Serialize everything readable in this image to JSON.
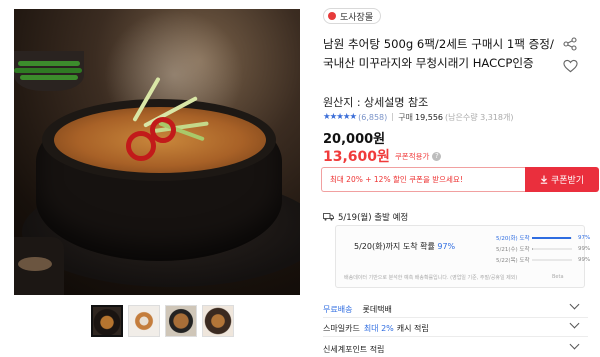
{
  "product": {
    "brand": "도사장몰",
    "title": "남원 추어탕 500g 6팩/2세트 구매시 1팩 증정/국내산 미꾸라지와 무청시래기 HACCP인증",
    "origin": "원산지 : 상세설명 참조",
    "rating": {
      "stars": "★★★★★",
      "reviews": "(6,858)",
      "purchases_label": "구매",
      "purchases": "19,556",
      "remaining": "(남은수량 3,318개)"
    },
    "price": "20,000원",
    "coupon_price": "13,600원",
    "coupon_tag": "쿠폰적용가",
    "coupon_help": "?"
  },
  "coupon": {
    "message": "최대 20% + 12% 할인 쿠폰을 받으세요!",
    "button": "쿠폰받기",
    "button_icon": "download-icon"
  },
  "delivery": {
    "departure": "5/19(월) 출발 예정",
    "forecast_main_prefix": "5/20(화)까지 도착 확률",
    "forecast_main_pct": "97%",
    "rows": [
      {
        "label": "5/20(화) 도착",
        "value": "97%",
        "fraction": 0.97,
        "color": "#2f6de1",
        "active": true
      },
      {
        "label": "5/21(수) 도착",
        "value": "99%",
        "fraction": 0.02,
        "color": "#b5b5b5",
        "active": false
      },
      {
        "label": "5/22(목) 도착",
        "value": "99%",
        "fraction": 0.0,
        "color": "#b5b5b5",
        "active": false
      }
    ],
    "footnote": "배송데이터 기반으로 분석한 예측 배송확률입니다. (영업일 기준, 주말/공휴일 제외)",
    "beta": "Beta"
  },
  "shipping": {
    "free_label": "무료배송",
    "carrier": "롯데택배",
    "card_label": "스마일카드",
    "card_highlight": "최대 2%",
    "card_suffix": "캐시 적립",
    "points_label": "신세계포인트 적립"
  },
  "icons": {
    "share": "share-icon",
    "wish": "heart-icon",
    "truck": "truck-icon"
  },
  "colors": {
    "accent_red": "#ea2f3d",
    "price_red": "#f03b3b",
    "link_blue": "#2f6de1"
  }
}
